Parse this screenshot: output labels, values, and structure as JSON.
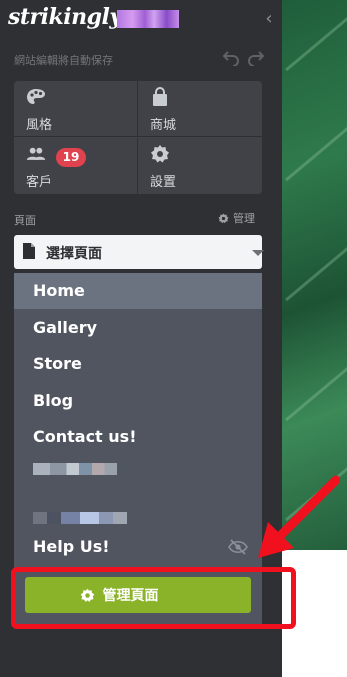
{
  "brand": {
    "logo_text": "strikingly"
  },
  "topbar": {
    "autosave_text": "網站編輯將自動保存"
  },
  "quick_menu": [
    {
      "label": "風格",
      "icon": "palette-icon"
    },
    {
      "label": "商城",
      "icon": "shopping-bag-icon"
    },
    {
      "label": "客戶",
      "icon": "people-icon",
      "badge": "19"
    },
    {
      "label": "設置",
      "icon": "gear-icon"
    }
  ],
  "pages": {
    "section_label": "頁面",
    "manage_label": "管理",
    "select_label": "選擇頁面",
    "items": [
      {
        "label": "Home",
        "active": true
      },
      {
        "label": "Gallery"
      },
      {
        "label": "Store"
      },
      {
        "label": "Blog"
      },
      {
        "label": "Contact us!"
      },
      {
        "label": "Help Us!",
        "hidden": true
      }
    ],
    "manage_button": "管理頁面"
  },
  "colors": {
    "sidebar_bg": "#2f3033",
    "accent_green": "#8ab32a",
    "badge_red": "#e0424f",
    "highlight_red": "#f0101e"
  }
}
